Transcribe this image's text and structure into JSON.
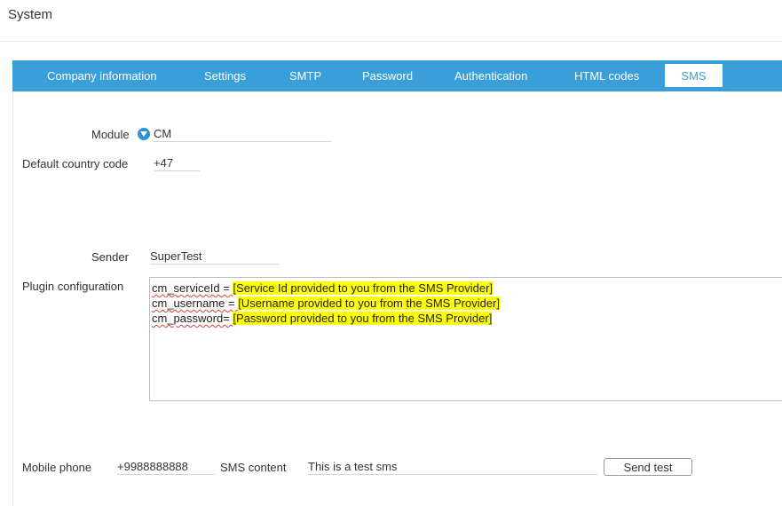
{
  "page": {
    "title": "System"
  },
  "tabs": [
    {
      "label": "Company information"
    },
    {
      "label": "Settings"
    },
    {
      "label": "SMTP"
    },
    {
      "label": "Password"
    },
    {
      "label": "Authentication"
    },
    {
      "label": "HTML codes"
    },
    {
      "label": "SMS",
      "active": true
    }
  ],
  "form": {
    "module_label": "Module",
    "module_value": "CM",
    "country_code_label": "Default country code",
    "country_code_value": "+47",
    "sender_label": "Sender",
    "sender_value": "SuperTest",
    "plugin_label": "Plugin configuration",
    "plugin_lines": [
      {
        "key": "cm_serviceId = ",
        "value": "[Service Id provided to you from the SMS Provider]"
      },
      {
        "key": "cm_username = ",
        "value": "[Username provided to you from the SMS Provider]  "
      },
      {
        "key": "cm_password= ",
        "value": "[Password provided to you from the SMS Provider]  "
      }
    ],
    "mobile_label": "Mobile phone",
    "mobile_value": "+9988888888",
    "sms_content_label": "SMS content",
    "sms_content_value": "This is a test sms",
    "send_test_label": "Send test"
  },
  "colors": {
    "tab_bar": "#3a9fd8",
    "highlight": "#ffff00",
    "dropdown_icon": "#2f93d1"
  },
  "icons": {
    "module_dropdown": "chevron-down-circle-icon"
  }
}
